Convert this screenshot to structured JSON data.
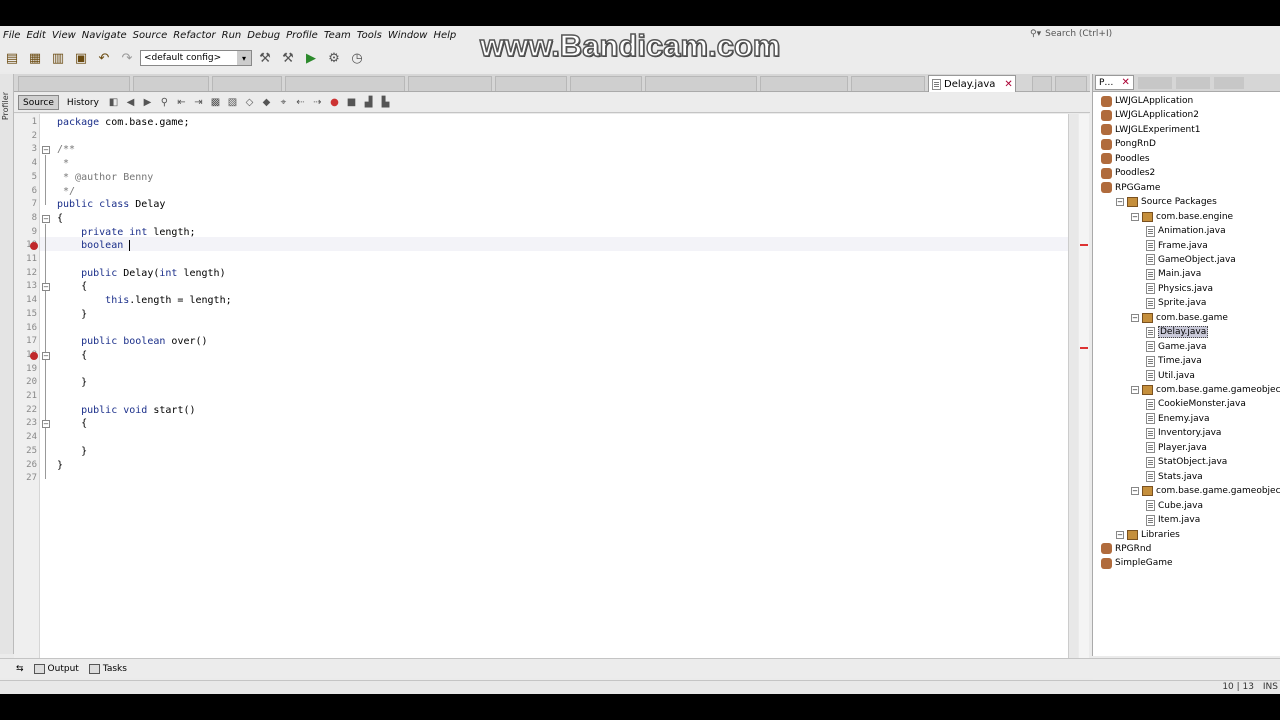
{
  "watermark": "www.Bandicam.com",
  "menu": [
    "File",
    "Edit",
    "View",
    "Navigate",
    "Source",
    "Refactor",
    "Run",
    "Debug",
    "Profile",
    "Team",
    "Tools",
    "Window",
    "Help"
  ],
  "search": {
    "placeholder": "Search (Ctrl+I)"
  },
  "toolbar": {
    "config": "<default config>"
  },
  "editor_tab": {
    "label": "Delay.java"
  },
  "editor_toolbar": {
    "source": "Source",
    "history": "History"
  },
  "left_strip": {
    "label": "Profiler"
  },
  "code": [
    {
      "num": "1",
      "text": "package com.base.game;"
    },
    {
      "num": "2",
      "text": ""
    },
    {
      "num": "3",
      "text": "/**"
    },
    {
      "num": "4",
      "text": " *"
    },
    {
      "num": "5",
      "text": " * @author Benny"
    },
    {
      "num": "6",
      "text": " */"
    },
    {
      "num": "7",
      "text": "public class Delay"
    },
    {
      "num": "8",
      "text": "{"
    },
    {
      "num": "9",
      "text": "    private int length;"
    },
    {
      "num": "10",
      "text": "    boolean"
    },
    {
      "num": "11",
      "text": ""
    },
    {
      "num": "12",
      "text": "    public Delay(int length)"
    },
    {
      "num": "13",
      "text": "    {"
    },
    {
      "num": "14",
      "text": "        this.length = length;"
    },
    {
      "num": "15",
      "text": "    }"
    },
    {
      "num": "16",
      "text": ""
    },
    {
      "num": "17",
      "text": "    public boolean over()"
    },
    {
      "num": "18",
      "text": "    {"
    },
    {
      "num": "19",
      "text": ""
    },
    {
      "num": "20",
      "text": "    }"
    },
    {
      "num": "21",
      "text": ""
    },
    {
      "num": "22",
      "text": "    public void start()"
    },
    {
      "num": "23",
      "text": "    {"
    },
    {
      "num": "24",
      "text": ""
    },
    {
      "num": "25",
      "text": "    }"
    },
    {
      "num": "26",
      "text": "}"
    },
    {
      "num": "27",
      "text": ""
    }
  ],
  "tree": [
    {
      "label": "LWJGLApplication",
      "type": "project",
      "depth": 0
    },
    {
      "label": "LWJGLApplication2",
      "type": "project",
      "depth": 0
    },
    {
      "label": "LWJGLExperiment1",
      "type": "project",
      "depth": 0
    },
    {
      "label": "PongRnD",
      "type": "project",
      "depth": 0
    },
    {
      "label": "Poodles",
      "type": "project",
      "depth": 0
    },
    {
      "label": "Poodles2",
      "type": "project",
      "depth": 0
    },
    {
      "label": "RPGGame",
      "type": "project",
      "depth": 0
    },
    {
      "label": "Source Packages",
      "type": "pkg",
      "depth": 1
    },
    {
      "label": "com.base.engine",
      "type": "pkg",
      "depth": 2
    },
    {
      "label": "Animation.java",
      "type": "file",
      "depth": 3
    },
    {
      "label": "Frame.java",
      "type": "file",
      "depth": 3
    },
    {
      "label": "GameObject.java",
      "type": "file",
      "depth": 3
    },
    {
      "label": "Main.java",
      "type": "file",
      "depth": 3
    },
    {
      "label": "Physics.java",
      "type": "file",
      "depth": 3
    },
    {
      "label": "Sprite.java",
      "type": "file",
      "depth": 3
    },
    {
      "label": "com.base.game",
      "type": "pkg",
      "depth": 2
    },
    {
      "label": "Delay.java",
      "type": "file",
      "depth": 3,
      "selected": true
    },
    {
      "label": "Game.java",
      "type": "file",
      "depth": 3
    },
    {
      "label": "Time.java",
      "type": "file",
      "depth": 3
    },
    {
      "label": "Util.java",
      "type": "file",
      "depth": 3
    },
    {
      "label": "com.base.game.gameobject",
      "type": "pkg",
      "depth": 2
    },
    {
      "label": "CookieMonster.java",
      "type": "file",
      "depth": 3
    },
    {
      "label": "Enemy.java",
      "type": "file",
      "depth": 3
    },
    {
      "label": "Inventory.java",
      "type": "file",
      "depth": 3
    },
    {
      "label": "Player.java",
      "type": "file",
      "depth": 3
    },
    {
      "label": "StatObject.java",
      "type": "file",
      "depth": 3
    },
    {
      "label": "Stats.java",
      "type": "file",
      "depth": 3
    },
    {
      "label": "com.base.game.gameobject.item",
      "type": "pkg",
      "depth": 2
    },
    {
      "label": "Cube.java",
      "type": "file",
      "depth": 3
    },
    {
      "label": "Item.java",
      "type": "file",
      "depth": 3
    },
    {
      "label": "Libraries",
      "type": "pkg",
      "depth": 1
    },
    {
      "label": "RPGRnd",
      "type": "project",
      "depth": 0
    },
    {
      "label": "SimpleGame",
      "type": "project",
      "depth": 0
    }
  ],
  "bottom": {
    "output": "Output",
    "tasks": "Tasks"
  },
  "status": {
    "position": "10 | 13",
    "mode": "INS"
  },
  "colors": {
    "keyword": "#1b2f8a",
    "error": "#c0282a",
    "selection": "#c9c9d9"
  }
}
